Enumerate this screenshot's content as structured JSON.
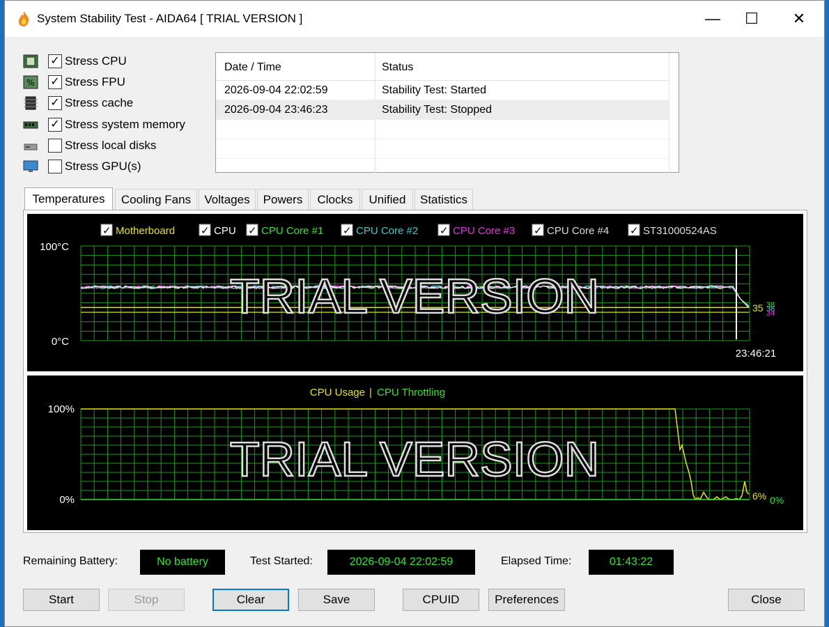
{
  "window": {
    "title": "System Stability Test - AIDA64  [ TRIAL VERSION ]",
    "minimize_glyph": "—",
    "maximize_glyph": "☐",
    "close_glyph": "✕"
  },
  "stress_options": [
    {
      "label": "Stress CPU",
      "checked": true,
      "icon": "cpu-icon"
    },
    {
      "label": "Stress FPU",
      "checked": true,
      "icon": "fpu-icon"
    },
    {
      "label": "Stress cache",
      "checked": true,
      "icon": "cache-icon"
    },
    {
      "label": "Stress system memory",
      "checked": true,
      "icon": "memory-icon"
    },
    {
      "label": "Stress local disks",
      "checked": false,
      "icon": "disk-icon"
    },
    {
      "label": "Stress GPU(s)",
      "checked": false,
      "icon": "gpu-icon"
    }
  ],
  "log": {
    "col_datetime": "Date / Time",
    "col_status": "Status",
    "rows": [
      {
        "datetime": "2026-09-04 22:02:59",
        "status": "Stability Test: Started"
      },
      {
        "datetime": "2026-09-04 23:46:23",
        "status": "Stability Test: Stopped"
      }
    ]
  },
  "tabs": [
    "Temperatures",
    "Cooling Fans",
    "Voltages",
    "Powers",
    "Clocks",
    "Unified",
    "Statistics"
  ],
  "active_tab": "Temperatures",
  "temp_graph": {
    "legend": [
      {
        "label": "Motherboard",
        "color": "#e6e600",
        "checked": true
      },
      {
        "label": "CPU",
        "color": "#ffffff",
        "checked": true
      },
      {
        "label": "CPU Core #1",
        "color": "#2ee62e",
        "checked": true
      },
      {
        "label": "CPU Core #2",
        "color": "#33cccc",
        "checked": true
      },
      {
        "label": "CPU Core #3",
        "color": "#e633e6",
        "checked": true
      },
      {
        "label": "CPU Core #4",
        "color": "#dddddd",
        "checked": true
      },
      {
        "label": "ST31000524AS",
        "color": "#dddddd",
        "checked": true
      }
    ],
    "y_max_label": "100°C",
    "y_min_label": "0°C",
    "time_label": "23:46:21",
    "watermark": "TRIAL VERSION",
    "end_values": [
      {
        "text": "35",
        "color": "#e6e600"
      },
      {
        "text": "38",
        "color": "#2ee62e"
      },
      {
        "text": "36",
        "color": "#33cccc"
      },
      {
        "text": "34",
        "color": "#e633e6"
      }
    ]
  },
  "cpu_graph": {
    "legend_usage": "CPU Usage",
    "legend_sep": "|",
    "legend_throttling": "CPU Throttling",
    "usage_color": "#e6e600",
    "throttle_color": "#2ee62e",
    "y_max_label": "100%",
    "y_min_label": "0%",
    "watermark": "TRIAL VERSION",
    "usage_end": "6%",
    "throttle_end": "0%"
  },
  "status_bar": {
    "battery_label": "Remaining Battery:",
    "battery_value": "No battery",
    "started_label": "Test Started:",
    "started_value": "2026-09-04 22:02:59",
    "elapsed_label": "Elapsed Time:",
    "elapsed_value": "01:43:22"
  },
  "buttons": {
    "start": "Start",
    "stop": "Stop",
    "clear": "Clear",
    "save": "Save",
    "cpuid": "CPUID",
    "preferences": "Preferences",
    "close": "Close"
  }
}
